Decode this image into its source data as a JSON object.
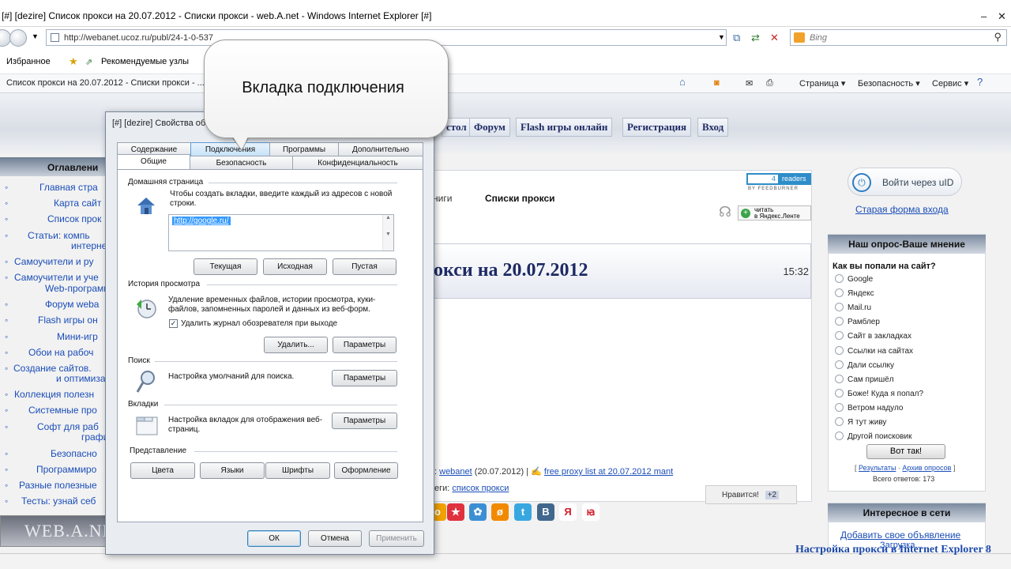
{
  "browser": {
    "window_title": "[#] [dezire] Список прокси на 20.07.2012 - Списки прокси - web.A.net - Windows Internet Explorer [#]",
    "url": "http://webanet.ucoz.ru/publ/24-1-0-537",
    "search_placeholder": "Bing",
    "favorites_label": "Избранное",
    "recommended_label": "Рекомендуемые узлы",
    "tab_title": "Список прокси на 20.07.2012 - Списки прокси - ...",
    "cmd_page": "Страница ▾",
    "cmd_security": "Безопасность ▾",
    "cmd_service": "Сервис ▾"
  },
  "webpage": {
    "topnav": [
      "стол",
      "Форум",
      "Flash игры онлайн",
      "Регистрация",
      "Вход"
    ],
    "left_heading": "Оглавлени",
    "left_nav": [
      "Главная стра",
      "Карта сайт",
      "Список прок",
      "Статьи: компь",
      "интернет",
      "Самоучители и ру",
      "Самоучители и уче",
      "Web-программ",
      "Форум webа",
      "Flash игры он",
      "Мини-игр",
      "Обои на рабоч",
      "Создание сайтов.",
      "и оптимизац",
      "Коллекция полезн",
      "Системные про",
      "Софт для раб",
      "графико",
      "Безопасно",
      "Программиро",
      "Разные полезные",
      "Тесты: узнай себ"
    ],
    "crumb_books": "ниги",
    "crumb_proxy": "Списки прокси",
    "feed_readers_count": "4",
    "feed_readers_label": "readers",
    "feed_by": "BY FEEDBURNER",
    "yandex_line1": "читать",
    "yandex_line2": "в Яндекс.Ленте",
    "article_title": "окси на 20.07.2012",
    "article_time": "15:32",
    "meta_author": "webanet",
    "meta_date": "(20.07.2012)",
    "meta_link": "free proxy list at 20.07.2012 mant",
    "tags_prefix": "еги:",
    "tags_link": "список прокси",
    "like_label": "Нравится!",
    "like_count": "+2",
    "uid_login": "Войти через uID",
    "old_login": "Старая форма входа",
    "poll_heading": "Наш опрос-Ваше мнение",
    "poll_question": "Как вы попали на сайт?",
    "poll_options": [
      "Google",
      "Яндекс",
      "Mail.ru",
      "Рамблер",
      "Сайт в закладках",
      "Ссылки на сайтах",
      "Дали ссылку",
      "Сам пришёл",
      "Боже! Куда я попал?",
      "Ветром надуло",
      "Я тут живу",
      "Другой поисковик"
    ],
    "poll_vote": "Вот так!",
    "poll_results": "Результаты",
    "poll_archive": "Архив опросов",
    "poll_total": "Всего ответов: 173",
    "interesting_heading": "Интересное в сети",
    "add_ad": "Добавить свое объявление",
    "loading": "Загрузка...",
    "logo_text": "WEB.A.NET",
    "bottom_caption": "Настройка прокси в Internet Explorer 8"
  },
  "dialog": {
    "title": "[#] [dezire] Свойства обо",
    "tabs_row1": [
      "Содержание",
      "Подключения",
      "Программы",
      "Дополнительно"
    ],
    "tabs_row2": [
      "Общие",
      "Безопасность",
      "Конфиденциальность"
    ],
    "home_group": "Домашняя страница",
    "home_text": "Чтобы создать вкладки, введите каждый из адресов с новой строки.",
    "home_url": "http://google.ru/",
    "btn_current": "Текущая",
    "btn_default": "Исходная",
    "btn_blank": "Пустая",
    "history_group": "История просмотра",
    "history_text": "Удаление временных файлов, истории просмотра, куки-файлов, запомненных паролей и данных из веб-форм.",
    "history_check": "Удалить журнал обозревателя при выходе",
    "btn_delete": "Удалить...",
    "btn_params": "Параметры",
    "search_group": "Поиск",
    "search_text": "Настройка умолчаний для поиска.",
    "tabs_group": "Вкладки",
    "tabs_text": "Настройка вкладок для отображения веб-страниц.",
    "view_group": "Представление",
    "btn_colors": "Цвета",
    "btn_langs": "Языки",
    "btn_fonts": "Шрифты",
    "btn_design": "Оформление",
    "btn_ok": "ОК",
    "btn_cancel": "Отмена",
    "btn_apply": "Применить"
  },
  "callout": {
    "text": "Вкладка подключения"
  }
}
